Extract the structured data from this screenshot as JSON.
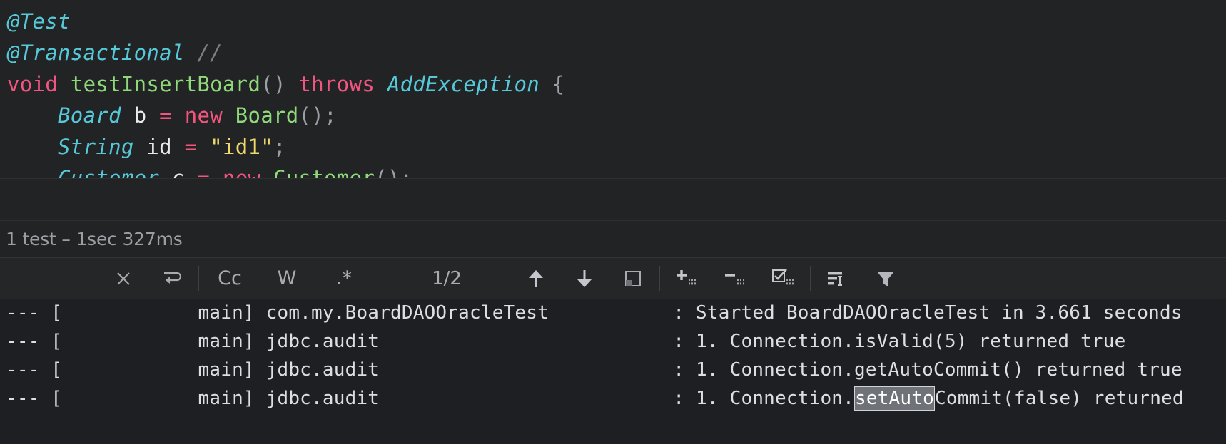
{
  "editor": {
    "lines": [
      {
        "id": "line-annot-test",
        "tokens": [
          {
            "text": "@Test",
            "cls": "t-annot"
          }
        ]
      },
      {
        "id": "line-annot-transactional",
        "tokens": [
          {
            "text": "@Transactional",
            "cls": "t-annot"
          },
          {
            "text": " ",
            "cls": "t-plain"
          },
          {
            "text": "//",
            "cls": "t-comment"
          }
        ]
      },
      {
        "id": "line-method-signature",
        "tokens": [
          {
            "text": "void",
            "cls": "t-kw"
          },
          {
            "text": " ",
            "cls": "t-plain"
          },
          {
            "text": "testInsertBoard",
            "cls": "t-method"
          },
          {
            "text": "()",
            "cls": "t-punc"
          },
          {
            "text": " ",
            "cls": "t-plain"
          },
          {
            "text": "throws",
            "cls": "t-kw"
          },
          {
            "text": " ",
            "cls": "t-plain"
          },
          {
            "text": "AddException",
            "cls": "t-type"
          },
          {
            "text": " ",
            "cls": "t-plain"
          },
          {
            "text": "{",
            "cls": "t-punc"
          }
        ]
      },
      {
        "id": "line-board-decl",
        "tokens": [
          {
            "text": "    ",
            "cls": "t-plain"
          },
          {
            "text": "Board",
            "cls": "t-type"
          },
          {
            "text": " ",
            "cls": "t-plain"
          },
          {
            "text": "b",
            "cls": "t-ident"
          },
          {
            "text": " ",
            "cls": "t-plain"
          },
          {
            "text": "=",
            "cls": "t-kw"
          },
          {
            "text": " ",
            "cls": "t-plain"
          },
          {
            "text": "new",
            "cls": "t-kw"
          },
          {
            "text": " ",
            "cls": "t-plain"
          },
          {
            "text": "Board",
            "cls": "t-method"
          },
          {
            "text": "();",
            "cls": "t-punc"
          }
        ]
      },
      {
        "id": "line-string-decl",
        "tokens": [
          {
            "text": "    ",
            "cls": "t-plain"
          },
          {
            "text": "String",
            "cls": "t-type"
          },
          {
            "text": " ",
            "cls": "t-plain"
          },
          {
            "text": "id",
            "cls": "t-ident"
          },
          {
            "text": " ",
            "cls": "t-plain"
          },
          {
            "text": "=",
            "cls": "t-kw"
          },
          {
            "text": " ",
            "cls": "t-plain"
          },
          {
            "text": "\"id1\"",
            "cls": "t-string"
          },
          {
            "text": ";",
            "cls": "t-punc"
          }
        ]
      },
      {
        "id": "line-customer-decl",
        "tokens": [
          {
            "text": "    ",
            "cls": "t-plain"
          },
          {
            "text": "Customer",
            "cls": "t-type"
          },
          {
            "text": " ",
            "cls": "t-plain"
          },
          {
            "text": "c",
            "cls": "t-ident"
          },
          {
            "text": " ",
            "cls": "t-plain"
          },
          {
            "text": "=",
            "cls": "t-kw"
          },
          {
            "text": " ",
            "cls": "t-plain"
          },
          {
            "text": "new",
            "cls": "t-kw"
          },
          {
            "text": " ",
            "cls": "t-plain"
          },
          {
            "text": "Customer",
            "cls": "t-method"
          },
          {
            "text": "();",
            "cls": "t-punc"
          }
        ]
      }
    ]
  },
  "test_status": {
    "text": "1 test – 1sec 327ms"
  },
  "find_toolbar": {
    "close_label": "✕",
    "close_icon": "close-icon",
    "wrap_icon": "find-wrap-arrow-icon",
    "match_case_label": "Cc",
    "whole_words_label": "W",
    "regex_label": ".*",
    "match_counter": "1/2",
    "prev_icon": "arrow-up-icon",
    "next_icon": "arrow-down-icon",
    "select_all_icon": "open-in-new-window-icon",
    "expand_all_icon": "expand-all-icon",
    "collapse_all_icon": "collapse-all-icon",
    "toggle_checkbox_icon": "select-checkbox-icon",
    "soft_wrap_icon": "soft-wrap-icon",
    "filter_icon": "filter-funnel-icon"
  },
  "console": {
    "lines": [
      {
        "id": "log-line-started",
        "parts": [
          {
            "text": "--- [            main] com.my.BoardDAOOracleTest           : Started BoardDAOOracleTest in 3.661 seconds",
            "hl": false
          }
        ]
      },
      {
        "id": "log-line-isvalid",
        "parts": [
          {
            "text": "--- [            main] jdbc.audit                          : 1. Connection.isValid(5) returned true",
            "hl": false
          }
        ]
      },
      {
        "id": "log-line-getautocommit",
        "parts": [
          {
            "text": "--- [            main] jdbc.audit                          : 1. Connection.getAutoCommit() returned true",
            "hl": false
          }
        ]
      },
      {
        "id": "log-line-setautocommit",
        "parts": [
          {
            "text": "--- [            main] jdbc.audit                          : 1. Connection.",
            "hl": false
          },
          {
            "text": "setAuto",
            "hl": true
          },
          {
            "text": "Commit(false) returned",
            "hl": false
          }
        ]
      }
    ]
  },
  "colors": {
    "editor_bg": "#222325",
    "console_bg": "#1e1f22",
    "toolbar_bg": "#252628",
    "highlight_bg": "#6f7276",
    "highlight_border": "#cfd2d6",
    "muted_text": "#9b9ea3"
  }
}
